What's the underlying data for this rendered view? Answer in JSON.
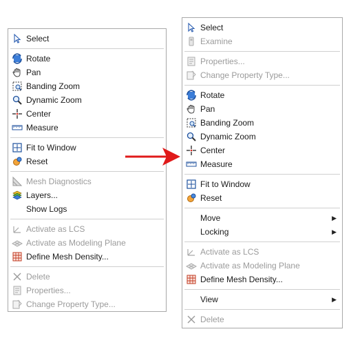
{
  "left_menu": {
    "items": [
      {
        "label": "Select",
        "icon": "cursor-icon"
      },
      {
        "label": "Rotate",
        "icon": "rotate-icon"
      },
      {
        "label": "Pan",
        "icon": "hand-icon"
      },
      {
        "label": "Banding Zoom",
        "icon": "banding-zoom-icon"
      },
      {
        "label": "Dynamic Zoom",
        "icon": "magnifier-icon"
      },
      {
        "label": "Center",
        "icon": "center-icon"
      },
      {
        "label": "Measure",
        "icon": "ruler-icon"
      },
      {
        "label": "Fit to Window",
        "icon": "fit-window-icon"
      },
      {
        "label": "Reset",
        "icon": "reset-icon"
      },
      {
        "label": "Mesh Diagnostics",
        "icon": "mesh-diagnostics-icon"
      },
      {
        "label": "Layers...",
        "icon": "layers-icon"
      },
      {
        "label": "Show Logs",
        "icon": ""
      },
      {
        "label": "Activate as LCS",
        "icon": "lcs-icon"
      },
      {
        "label": "Activate as Modeling Plane",
        "icon": "modeling-plane-icon"
      },
      {
        "label": "Define Mesh Density...",
        "icon": "mesh-density-icon"
      },
      {
        "label": "Delete",
        "icon": "delete-icon"
      },
      {
        "label": "Properties...",
        "icon": "properties-icon"
      },
      {
        "label": "Change Property Type...",
        "icon": "change-property-icon"
      }
    ]
  },
  "right_menu": {
    "items": [
      {
        "label": "Select",
        "icon": "cursor-icon"
      },
      {
        "label": "Examine",
        "icon": "examine-icon"
      },
      {
        "label": "Properties...",
        "icon": "properties-icon"
      },
      {
        "label": "Change Property Type...",
        "icon": "change-property-icon"
      },
      {
        "label": "Rotate",
        "icon": "rotate-icon"
      },
      {
        "label": "Pan",
        "icon": "hand-icon"
      },
      {
        "label": "Banding Zoom",
        "icon": "banding-zoom-icon"
      },
      {
        "label": "Dynamic Zoom",
        "icon": "magnifier-icon"
      },
      {
        "label": "Center",
        "icon": "center-icon"
      },
      {
        "label": "Measure",
        "icon": "ruler-icon"
      },
      {
        "label": "Fit to Window",
        "icon": "fit-window-icon"
      },
      {
        "label": "Reset",
        "icon": "reset-icon"
      },
      {
        "label": "Move",
        "icon": ""
      },
      {
        "label": "Locking",
        "icon": ""
      },
      {
        "label": "Activate as LCS",
        "icon": "lcs-icon"
      },
      {
        "label": "Activate as Modeling Plane",
        "icon": "modeling-plane-icon"
      },
      {
        "label": "Define Mesh Density...",
        "icon": "mesh-density-icon"
      },
      {
        "label": "View",
        "icon": ""
      },
      {
        "label": "Delete",
        "icon": "delete-icon"
      }
    ]
  },
  "colors": {
    "arrow": "#e01a1a",
    "separator": "#cfcfcf",
    "disabled_text": "#9b9b9b"
  }
}
